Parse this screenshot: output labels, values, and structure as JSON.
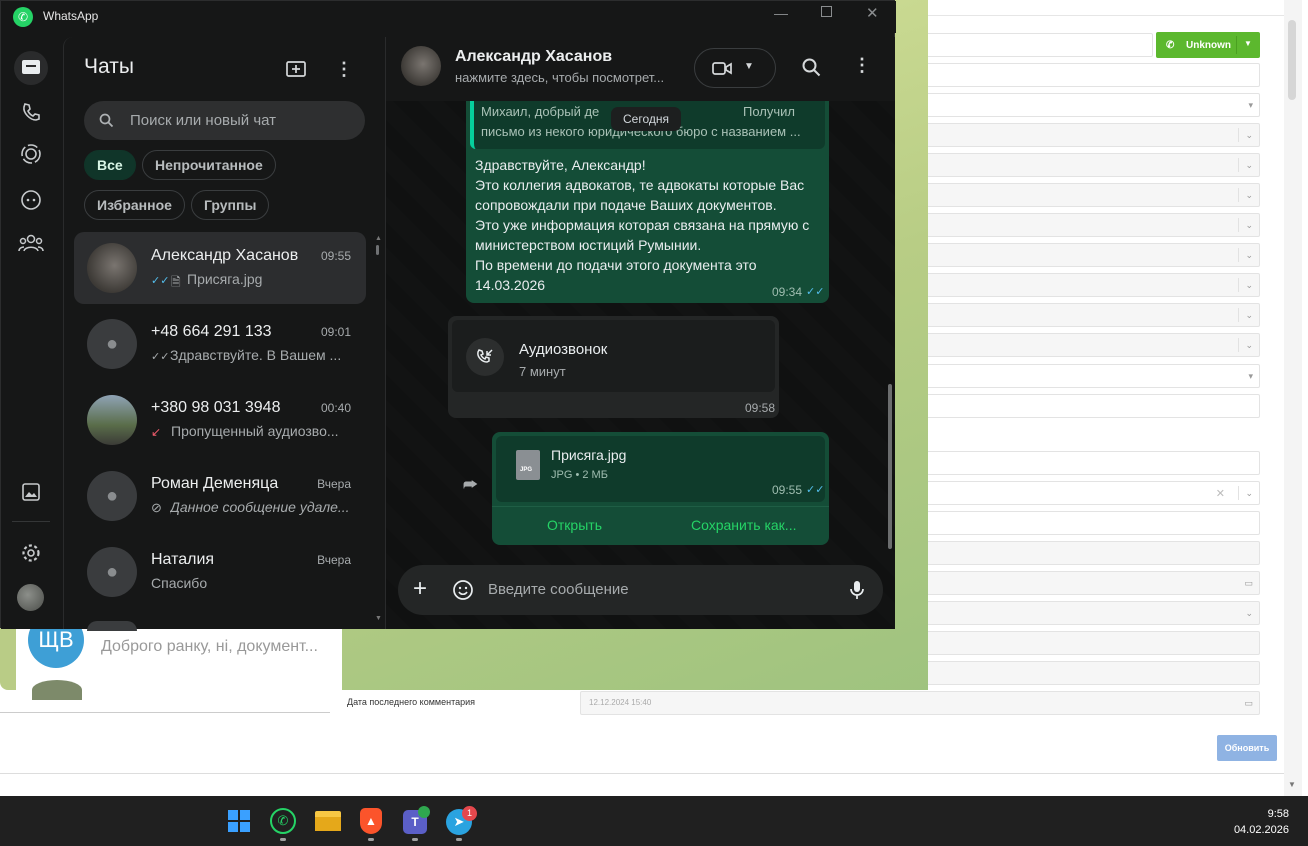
{
  "crm": {
    "button_unknown": "Unknown",
    "field_label_last_comment": "Дата последнего комментария",
    "field_value_last_comment": "12.12.2024 15:40",
    "button_refresh": "Обновить"
  },
  "telegram": {
    "chat_avatar_initials": "ЩВ",
    "chat_preview": "Доброго ранку, ні, документ..."
  },
  "whatsapp": {
    "app_title": "WhatsApp",
    "sidebar": {
      "title": "Чаты",
      "search_placeholder": "Поиск или новый чат",
      "filters": [
        "Все",
        "Непрочитанное",
        "Избранное",
        "Группы"
      ],
      "chats": [
        {
          "name": "Александр Хасанов",
          "time": "09:55",
          "preview": "Присяга.jpg"
        },
        {
          "name": "+48 664 291 133",
          "time": "09:01",
          "preview": "Здравствуйте. В Вашем ..."
        },
        {
          "name": "+380 98 031 3948",
          "time": "00:40",
          "preview": "Пропущенный аудиозво..."
        },
        {
          "name": "Роман Деменяца",
          "time": "Вчера",
          "preview": "Данное сообщение удале..."
        },
        {
          "name": "Наталия",
          "time": "Вчера",
          "preview": "Спасибо"
        }
      ]
    },
    "conversation": {
      "contact_name": "Александр Хасанов",
      "contact_subtitle": "нажмите здесь, чтобы посмотрет...",
      "date_chip": "Сегодня",
      "quoted_text_1": "Михаил, добрый де",
      "quoted_text_1b": "Получил",
      "quoted_text_2": "письмо из некого юридического бюро с названием ...",
      "message_lines": [
        "Здравствуйте, Александр!",
        "Это коллегия адвокатов, те адвокаты которые Вас",
        "сопровождали при подаче Ваших документов.",
        "Это уже информация которая связана на прямую с",
        "министерством юстиций Румынии.",
        "По времени до подачи этого документа это",
        "14.03.2026"
      ],
      "message_time": "09:34",
      "call_title": "Аудиозвонок",
      "call_duration": "7 минут",
      "call_time": "09:58",
      "file_name": "Присяга.jpg",
      "file_meta": "JPG • 2 МБ",
      "file_badge": "JPG",
      "file_time": "09:55",
      "file_open": "Открыть",
      "file_save": "Сохранить как...",
      "composer_placeholder": "Введите сообщение"
    }
  },
  "taskbar": {
    "time": "9:58",
    "date": "04.02.2026",
    "telegram_badge": "1"
  },
  "colors": {
    "wa_green": "#25d366",
    "wa_bubble_out": "#144d37",
    "wa_bg": "#161717",
    "crm_button_green": "#5cb82e",
    "crm_button_blue": "#8fb3e3"
  }
}
